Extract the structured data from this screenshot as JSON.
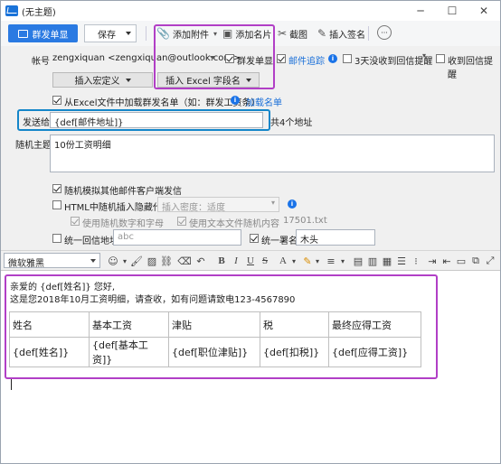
{
  "window": {
    "title": "(无主题)"
  },
  "toolbar": {
    "send_label": "群发单显",
    "save_label": "保存",
    "attach_label": "添加附件",
    "card_label": "添加名片",
    "screenshot_label": "截图",
    "signature_label": "插入签名",
    "more_label": "···"
  },
  "account": {
    "label": "帐号",
    "value": "zengxiquan <zengxiquan@outlook.com>",
    "group_single_display": "群发单显",
    "mail_tracking": "邮件追踪",
    "reminder": "3天没收到回信提醒",
    "reply_reminder": "收到回信提醒"
  },
  "insert": {
    "macro_label": "插入宏定义",
    "excel_field_label": "插入 Excel 字段名"
  },
  "excel_load": {
    "label": "从Excel文件中加载群发名单（如：群发工资条）",
    "link": "加载名单"
  },
  "recipient": {
    "label": "发送给",
    "value": "{def[邮件地址]}",
    "count": "共4个地址"
  },
  "subject": {
    "label": "随机主题",
    "value": "10份工资明细"
  },
  "options": {
    "simulate_client": "随机模拟其他邮件客户端发信",
    "html_hidden": "HTML中随机插入隐藏代码",
    "insert_density_placeholder": "插入密度：适度",
    "use_random_chars": "使用随机数字和字母",
    "use_text_random": "使用文本文件随机内容",
    "text_count": "17501.txt",
    "unified_reply": "统一回信地址",
    "reply_placeholder": "abc",
    "unified_signature": "统一署名",
    "signature_value": "木头"
  },
  "format": {
    "font": "微软雅黑"
  },
  "body": {
    "greeting": "亲爱的 {def[姓名]} 您好,",
    "line2": "这是您2018年10月工资明细，请查收，如有问题请致电123-4567890",
    "table_headers": [
      "姓名",
      "基本工资",
      "津贴",
      "税",
      "最终应得工资"
    ],
    "table_values": [
      "{def[姓名]}",
      "{def[基本工资]}",
      "{def[职位津贴]}",
      "{def[扣税]}",
      "{def[应得工资]}"
    ]
  }
}
